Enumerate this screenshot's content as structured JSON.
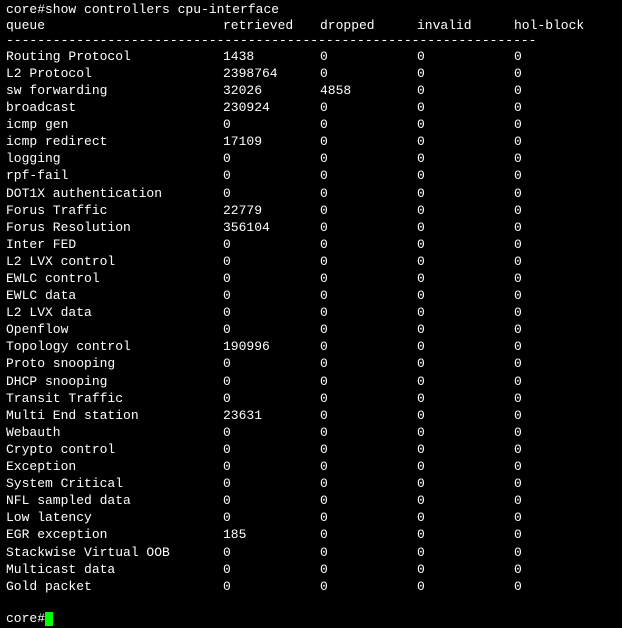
{
  "command_line": "core#show controllers cpu-interface",
  "headers": {
    "queue": "queue",
    "retrieved": "retrieved",
    "dropped": "dropped",
    "invalid": "invalid",
    "hol_block": "hol-block"
  },
  "divider": "--------------------------------------------------------------------",
  "rows": [
    {
      "queue": "Routing Protocol",
      "retrieved": "1438",
      "dropped": "0",
      "invalid": "0",
      "hol_block": "0"
    },
    {
      "queue": "L2 Protocol",
      "retrieved": "2398764",
      "dropped": "0",
      "invalid": "0",
      "hol_block": "0"
    },
    {
      "queue": "sw forwarding",
      "retrieved": "32026",
      "dropped": "4858",
      "invalid": "0",
      "hol_block": "0"
    },
    {
      "queue": "broadcast",
      "retrieved": "230924",
      "dropped": "0",
      "invalid": "0",
      "hol_block": "0"
    },
    {
      "queue": "icmp gen",
      "retrieved": "0",
      "dropped": "0",
      "invalid": "0",
      "hol_block": "0"
    },
    {
      "queue": "icmp redirect",
      "retrieved": "17109",
      "dropped": "0",
      "invalid": "0",
      "hol_block": "0"
    },
    {
      "queue": "logging",
      "retrieved": "0",
      "dropped": "0",
      "invalid": "0",
      "hol_block": "0"
    },
    {
      "queue": "rpf-fail",
      "retrieved": "0",
      "dropped": "0",
      "invalid": "0",
      "hol_block": "0"
    },
    {
      "queue": "DOT1X authentication",
      "retrieved": "0",
      "dropped": "0",
      "invalid": "0",
      "hol_block": "0"
    },
    {
      "queue": "Forus Traffic",
      "retrieved": "22779",
      "dropped": "0",
      "invalid": "0",
      "hol_block": "0"
    },
    {
      "queue": "Forus Resolution",
      "retrieved": "356104",
      "dropped": "0",
      "invalid": "0",
      "hol_block": "0"
    },
    {
      "queue": "Inter FED",
      "retrieved": "0",
      "dropped": "0",
      "invalid": "0",
      "hol_block": "0"
    },
    {
      "queue": "L2 LVX control",
      "retrieved": "0",
      "dropped": "0",
      "invalid": "0",
      "hol_block": "0"
    },
    {
      "queue": "EWLC control",
      "retrieved": "0",
      "dropped": "0",
      "invalid": "0",
      "hol_block": "0"
    },
    {
      "queue": "EWLC data",
      "retrieved": "0",
      "dropped": "0",
      "invalid": "0",
      "hol_block": "0"
    },
    {
      "queue": "L2 LVX data",
      "retrieved": "0",
      "dropped": "0",
      "invalid": "0",
      "hol_block": "0"
    },
    {
      "queue": "Openflow",
      "retrieved": "0",
      "dropped": "0",
      "invalid": "0",
      "hol_block": "0"
    },
    {
      "queue": "Topology control",
      "retrieved": "190996",
      "dropped": "0",
      "invalid": "0",
      "hol_block": "0"
    },
    {
      "queue": "Proto snooping",
      "retrieved": "0",
      "dropped": "0",
      "invalid": "0",
      "hol_block": "0"
    },
    {
      "queue": "DHCP snooping",
      "retrieved": "0",
      "dropped": "0",
      "invalid": "0",
      "hol_block": "0"
    },
    {
      "queue": "Transit Traffic",
      "retrieved": "0",
      "dropped": "0",
      "invalid": "0",
      "hol_block": "0"
    },
    {
      "queue": "Multi End station",
      "retrieved": "23631",
      "dropped": "0",
      "invalid": "0",
      "hol_block": "0"
    },
    {
      "queue": "Webauth",
      "retrieved": "0",
      "dropped": "0",
      "invalid": "0",
      "hol_block": "0"
    },
    {
      "queue": "Crypto control",
      "retrieved": "0",
      "dropped": "0",
      "invalid": "0",
      "hol_block": "0"
    },
    {
      "queue": "Exception",
      "retrieved": "0",
      "dropped": "0",
      "invalid": "0",
      "hol_block": "0"
    },
    {
      "queue": "System Critical",
      "retrieved": "0",
      "dropped": "0",
      "invalid": "0",
      "hol_block": "0"
    },
    {
      "queue": "NFL sampled data",
      "retrieved": "0",
      "dropped": "0",
      "invalid": "0",
      "hol_block": "0"
    },
    {
      "queue": "Low latency",
      "retrieved": "0",
      "dropped": "0",
      "invalid": "0",
      "hol_block": "0"
    },
    {
      "queue": "EGR exception",
      "retrieved": "185",
      "dropped": "0",
      "invalid": "0",
      "hol_block": "0"
    },
    {
      "queue": "Stackwise Virtual OOB",
      "retrieved": "0",
      "dropped": "0",
      "invalid": "0",
      "hol_block": "0"
    },
    {
      "queue": "Multicast data",
      "retrieved": "0",
      "dropped": "0",
      "invalid": "0",
      "hol_block": "0"
    },
    {
      "queue": "Gold packet",
      "retrieved": "0",
      "dropped": "0",
      "invalid": "0",
      "hol_block": "0"
    }
  ],
  "prompt": "core#"
}
